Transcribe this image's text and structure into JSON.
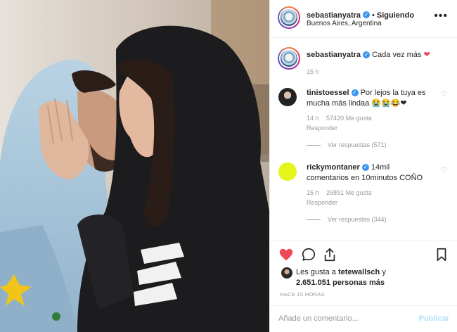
{
  "post": {
    "username": "sebastianyatra",
    "follow_status": "Siguiendo",
    "separator": "•",
    "location": "Buenos Aires, Argentina",
    "more_label": "•••"
  },
  "caption": {
    "username": "sebastianyatra",
    "text": "Cada vez más",
    "emoji": "❤",
    "time": "15 h"
  },
  "comments": [
    {
      "username": "tinistoessel",
      "text": "Por lejos la tuya es mucha más lindaa",
      "emojis": "😭😭😂❤",
      "time": "14 h",
      "likes": "57420 Me gusta",
      "reply": "Responder",
      "view_replies": "Ver respuestas (571)"
    },
    {
      "username": "rickymontaner",
      "text": "14mil comentarios en 10minutos COÑO",
      "emojis": "",
      "time": "15 h",
      "likes": "26891 Me gusta",
      "reply": "Responder",
      "view_replies": "Ver respuestas (344)"
    }
  ],
  "likes": {
    "prefix": "Les gusta a",
    "user": "tetewallsch",
    "conj": "y",
    "count": "2.651.051 personas más"
  },
  "timestamp": "HACE 15 HORAS",
  "add_comment": {
    "placeholder": "Añade un comentario...",
    "publish": "Publicar"
  },
  "icons": {
    "heart": "heart-icon",
    "comment": "comment-icon",
    "share": "share-icon",
    "save": "bookmark-icon"
  },
  "colors": {
    "heart": "#ed4956",
    "verified": "#3897f0",
    "publish": "#b2dffc",
    "ricky_avatar": "#e3f51a"
  }
}
